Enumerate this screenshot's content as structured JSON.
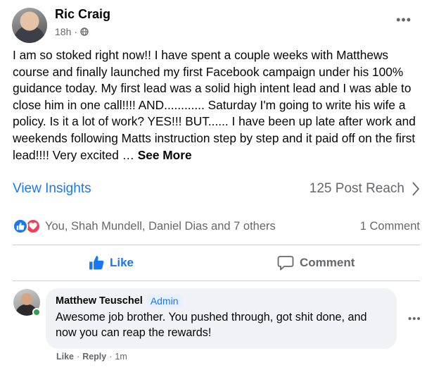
{
  "post": {
    "author": "Ric Craig",
    "time": "18h",
    "separator": "·",
    "more": "•••",
    "text": "I am so stoked right now!! I have spent a couple weeks with Matthews course and finally launched my first Facebook campaign under his 100% guidance today. My first lead was a solid high intent lead and I was able to close him in one call!!!! AND............ Saturday I'm going to write his wife a policy. Is it a lot of work? YES!!! BUT...... I have been up late after work and weekends following Matts instruction step by step and it paid off on the first lead!!!!  Very excited …",
    "see_more": "See More"
  },
  "insights": {
    "view_label": "View Insights",
    "reach": "125 Post Reach"
  },
  "reactions": {
    "names": "You, Shah Mundell, Daniel Dias and 7 others",
    "comment_count": "1 Comment"
  },
  "actions": {
    "like": "Like",
    "comment": "Comment"
  },
  "comment": {
    "author": "Matthew Teuschel",
    "badge": "Admin",
    "text": "Awesome job brother. You pushed through, got shit done, and now you can reap the rewards!",
    "more": "•••",
    "like": "Like",
    "dot": "·",
    "reply": "Reply",
    "time": "1m"
  },
  "colors": {
    "accent": "#1877f2",
    "secondary_text": "#65676b",
    "love": "#f33e58",
    "online": "#31a24c",
    "bubble": "#f0f2f5"
  },
  "icons": [
    "globe-icon",
    "more-icon",
    "chevron-right-icon",
    "like-reaction-icon",
    "love-reaction-icon",
    "thumbs-up-icon",
    "comment-icon"
  ]
}
